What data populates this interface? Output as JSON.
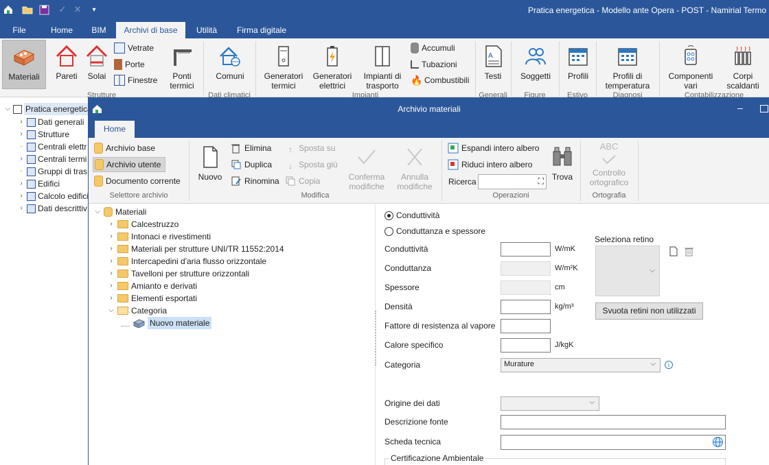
{
  "app": {
    "title": "Pratica energetica - Modello ante Opera - POST - Namirial Termo"
  },
  "menu": {
    "tabs": [
      "File",
      "Home",
      "BIM",
      "Archivi di base",
      "Utilità",
      "Firma digitale"
    ],
    "active": "Archivi di base"
  },
  "ribbon": {
    "materiali": "Materiali",
    "pareti": "Pareti",
    "solai": "Solai",
    "vetrate": "Vetrate",
    "porte": "Porte",
    "finestre": "Finestre",
    "ponti_termici": "Ponti termici",
    "comuni": "Comuni",
    "generatori_termici": "Generatori termici",
    "generatori_elettrici": "Generatori elettrici",
    "impianti_trasporto": "Impianti di trasporto",
    "accumuli": "Accumuli",
    "tubazioni": "Tubazioni",
    "combustibili": "Combustibili",
    "testi": "Testi",
    "soggetti": "Soggetti",
    "profili": "Profili",
    "profili_temperatura": "Profili di temperatura",
    "componenti_vari": "Componenti vari",
    "corpi_scaldanti": "Corpi scaldanti",
    "groups": {
      "strutture": "Strutture",
      "dati_climatici": "Dati climatici",
      "impianti": "Impianti",
      "generali": "Generali",
      "figure": "Figure",
      "estivo": "Estivo",
      "diagnosi": "Diagnosi",
      "contabilizzazione": "Contabilizzazione"
    }
  },
  "left_tree": {
    "root": "Pratica energetica",
    "items": [
      "Dati generali",
      "Strutture",
      "Centrali elettr",
      "Centrali termi",
      "Gruppi di tras",
      "Edifici",
      "Calcolo edifici",
      "Dati descrittiv"
    ]
  },
  "dialog": {
    "title": "Archivio materiali",
    "tab": "Home",
    "selettore": {
      "archivio_base": "Archivio base",
      "archivio_utente": "Archivio utente",
      "documento_corrente": "Documento corrente",
      "group": "Selettore archivio"
    },
    "modifica": {
      "nuovo": "Nuovo",
      "elimina": "Elimina",
      "duplica": "Duplica",
      "rinomina": "Rinomina",
      "sposta_su": "Sposta su",
      "sposta_giu": "Sposta giù",
      "copia": "Copia",
      "conferma": "Conferma modifiche",
      "annulla": "Annulla modifiche",
      "group": "Modifica"
    },
    "operazioni": {
      "espandi": "Espandi intero albero",
      "riduci": "Riduci intero albero",
      "ricerca": "Ricerca",
      "trova": "Trova",
      "group": "Operazioni"
    },
    "ortografia": {
      "controllo": "Controllo ortografico",
      "abc": "ABC",
      "group": "Ortografia"
    },
    "tree": {
      "root": "Materiali",
      "folders": [
        "Calcestruzzo",
        "Intonaci e rivestimenti",
        "Materiali per strutture UNI/TR 11552:2014",
        "Intercapedini d'aria flusso orizzontale",
        "Tavelloni per strutture orizzontali",
        "Amianto e derivati",
        "Elementi esportati",
        "Categoria"
      ],
      "selected_child": "Nuovo materiale"
    },
    "form": {
      "radio_conduttivita": "Conduttività",
      "radio_conduttanza": "Conduttanza e spessore",
      "conduttivita": {
        "label": "Conduttività",
        "unit": "W/mK",
        "value": ""
      },
      "conduttanza": {
        "label": "Conduttanza",
        "unit": "W/m²K",
        "value": ""
      },
      "spessore": {
        "label": "Spessore",
        "unit": "cm",
        "value": ""
      },
      "densita": {
        "label": "Densità",
        "unit": "kg/m³",
        "value": ""
      },
      "resistenza_vapore": {
        "label": "Fattore di resistenza al vapore",
        "value": ""
      },
      "calore_specifico": {
        "label": "Calore specifico",
        "unit": "J/kgK",
        "value": ""
      },
      "categoria": {
        "label": "Categoria",
        "value": "Murature"
      },
      "origine": {
        "label": "Origine dei dati",
        "value": ""
      },
      "descrizione_fonte": {
        "label": "Descrizione fonte",
        "value": ""
      },
      "scheda_tecnica": {
        "label": "Scheda tecnica",
        "value": ""
      },
      "certificazione": "Certificazione Ambientale",
      "seleziona_retino": "Seleziona retino",
      "svuota_retini": "Svuota retini non utilizzati"
    }
  }
}
